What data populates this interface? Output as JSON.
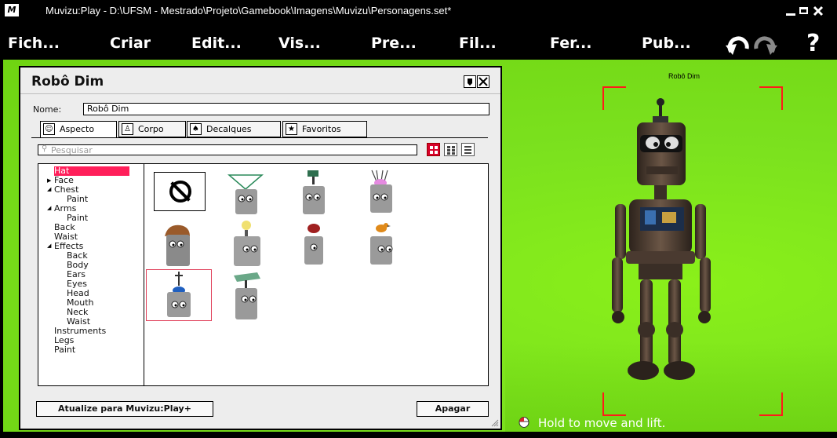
{
  "window": {
    "logo": "M",
    "title": "Muvizu:Play - D:\\UFSM - Mestrado\\Projeto\\Gamebook\\Imagens\\Muvizu\\Personagens.set*"
  },
  "menu": [
    "Fich...",
    "Criar",
    "Edit...",
    "Vis...",
    "Pre...",
    "Fil...",
    "Fer...",
    "Pub..."
  ],
  "help_label": "?",
  "panel": {
    "title": "Robô Dim",
    "name_label": "Nome:",
    "name_value": "Robô Dim",
    "tabs": [
      "Aspecto",
      "Corpo",
      "Decalques",
      "Favoritos"
    ],
    "search_placeholder": "Pesquisar",
    "tree": [
      "Hat",
      "Face",
      "Chest",
      "Paint",
      "Arms",
      "Paint",
      "Back",
      "Waist",
      "Effects",
      "Back",
      "Body",
      "Ears",
      "Eyes",
      "Head",
      "Mouth",
      "Neck",
      "Waist",
      "Instruments",
      "Legs",
      "Paint"
    ],
    "selected_tree_item": "Hat",
    "upgrade_button": "Atualize para Muvizu:Play+",
    "delete_button": "Apagar"
  },
  "viewport": {
    "character_label": "Robô Dim",
    "hint": "Hold to move and lift."
  },
  "colors": {
    "stage_green": "#7be11e",
    "selection_red": "#ff1f5a",
    "frame_red": "#ff1a1a"
  }
}
